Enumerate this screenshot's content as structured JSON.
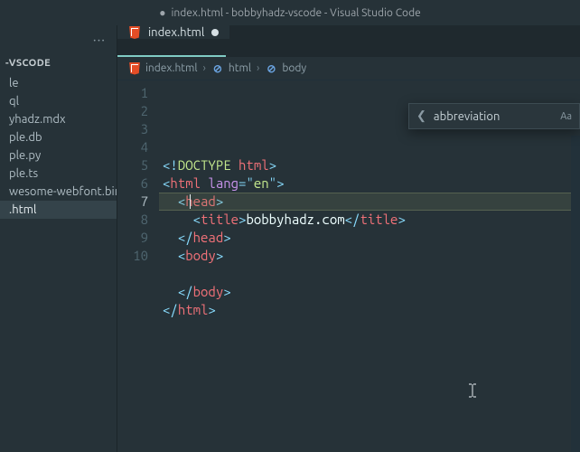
{
  "titlebar": {
    "dirty_marker": "●",
    "text": "index.html - bobbyhadz-vscode - Visual Studio Code"
  },
  "sidebar": {
    "folder": "-VSCODE",
    "files": [
      {
        "name": "le"
      },
      {
        "name": "ql"
      },
      {
        "name": "yhadz.mdx"
      },
      {
        "name": "ple.db"
      },
      {
        "name": "ple.py"
      },
      {
        "name": "ple.ts"
      },
      {
        "name": "wesome-webfont.bin"
      },
      {
        "name": ".html",
        "active": true
      }
    ]
  },
  "tab": {
    "label": "index.html"
  },
  "breadcrumbs": {
    "items": [
      {
        "icon": "html5",
        "label": "index.html"
      },
      {
        "icon": "brace",
        "label": "html"
      },
      {
        "icon": "brace",
        "label": "body"
      }
    ]
  },
  "code": {
    "lines": [
      {
        "n": 1,
        "html": "<span class='tok-punc'>&lt;!</span><span class='tok-doctype'>DOCTYPE</span> <span class='tok-kw'>html</span><span class='tok-punc'>&gt;</span>"
      },
      {
        "n": 2,
        "html": "<span class='tok-punc'>&lt;</span><span class='tok-tag'>html</span> <span class='tok-attr'>lang</span><span class='tok-op'>=</span><span class='tok-punc'>\"</span><span class='tok-str'>en</span><span class='tok-punc'>\"</span><span class='tok-punc'>&gt;</span>"
      },
      {
        "n": 3,
        "html": "  <span class='tok-punc'>&lt;</span><span class='tok-tag'>head</span><span class='tok-punc'>&gt;</span>"
      },
      {
        "n": 4,
        "html": "    <span class='tok-punc'>&lt;</span><span class='tok-tag'>title</span><span class='tok-punc'>&gt;</span><span class='tok-text'>bobbyhadz.com</span><span class='tok-punc'>&lt;/</span><span class='tok-tag'>title</span><span class='tok-punc'>&gt;</span>"
      },
      {
        "n": 5,
        "html": "  <span class='tok-punc'>&lt;/</span><span class='tok-tag'>head</span><span class='tok-punc'>&gt;</span>"
      },
      {
        "n": 6,
        "html": "  <span class='tok-punc'>&lt;</span><span class='tok-tag'>body</span><span class='tok-punc'>&gt;</span>"
      },
      {
        "n": 7,
        "html": "    "
      },
      {
        "n": 8,
        "html": "  <span class='tok-punc'>&lt;/</span><span class='tok-tag'>body</span><span class='tok-punc'>&gt;</span>"
      },
      {
        "n": 9,
        "html": "<span class='tok-punc'>&lt;/</span><span class='tok-tag'>html</span><span class='tok-punc'>&gt;</span>"
      },
      {
        "n": 10,
        "html": ""
      }
    ],
    "current_line": 7
  },
  "suggest": {
    "label": "abbreviation",
    "hint": "Aa"
  }
}
